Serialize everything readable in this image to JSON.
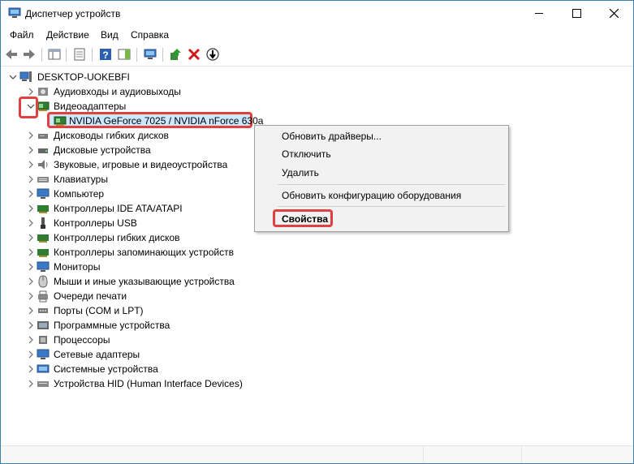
{
  "window": {
    "title": "Диспетчер устройств"
  },
  "menubar": [
    "Файл",
    "Действие",
    "Вид",
    "Справка"
  ],
  "tree": {
    "root": "DESKTOP-UOKEBFI",
    "categories": [
      "Аудиовходы и аудиовыходы",
      "Видеоадаптеры",
      "Дисководы гибких дисков",
      "Дисковые устройства",
      "Звуковые, игровые и видеоустройства",
      "Клавиатуры",
      "Компьютер",
      "Контроллеры IDE ATA/ATAPI",
      "Контроллеры USB",
      "Контроллеры гибких дисков",
      "Контроллеры запоминающих устройств",
      "Мониторы",
      "Мыши и иные указывающие устройства",
      "Очереди печати",
      "Порты (COM и LPT)",
      "Программные устройства",
      "Процессоры",
      "Сетевые адаптеры",
      "Системные устройства",
      "Устройства HID (Human Interface Devices)"
    ],
    "selected_device": "NVIDIA GeForce 7025 / NVIDIA nForce 630a"
  },
  "context_menu": {
    "update_driver": "Обновить драйверы...",
    "disable": "Отключить",
    "uninstall": "Удалить",
    "scan_hardware": "Обновить конфигурацию оборудования",
    "properties": "Свойства"
  },
  "colors": {
    "highlight_outline": "#e04040",
    "selection": "#cce8ff",
    "window_border": "#3c7fb1"
  }
}
